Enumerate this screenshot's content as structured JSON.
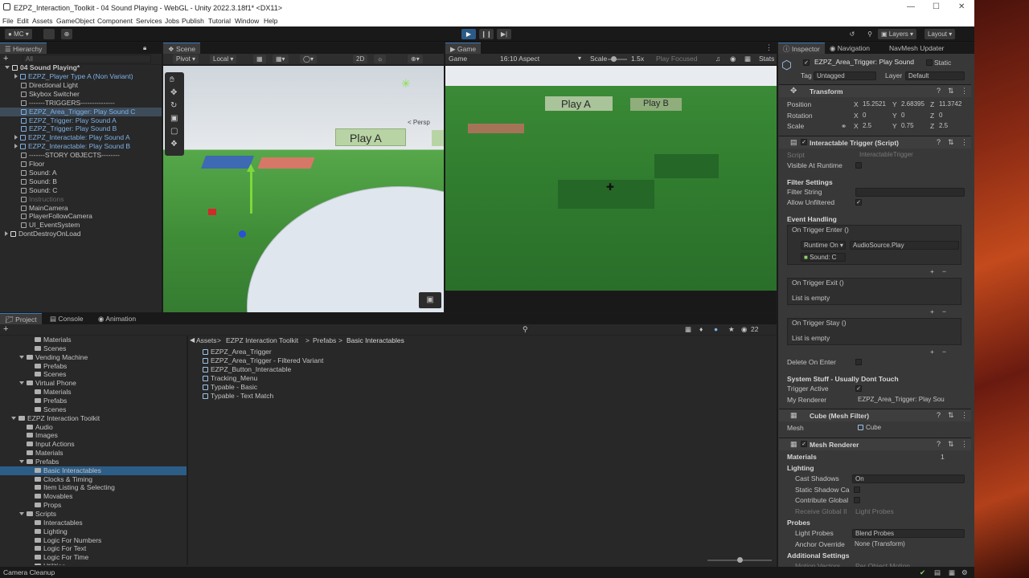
{
  "window": {
    "title": "EZPZ_Interaction_Toolkit - 04 Sound Playing - WebGL - Unity 2022.3.18f1* <DX11>",
    "min": "—",
    "max": "☐",
    "close": "✕"
  },
  "menu": [
    "File",
    "Edit",
    "Assets",
    "GameObject",
    "Component",
    "Services",
    "Jobs",
    "Publish",
    "Tutorial",
    "Window",
    "Help"
  ],
  "toolbar": {
    "account": "MC",
    "layers": "Layers",
    "layout": "Layout"
  },
  "hierarchy": {
    "tab": "Hierarchy",
    "search": "All",
    "scene": "04 Sound Playing*",
    "items": [
      {
        "label": "EZPZ_Player Type A (Non Variant)",
        "indent": 1,
        "blue": true,
        "arrow": true
      },
      {
        "label": "Directional Light",
        "indent": 1
      },
      {
        "label": "Skybox Switcher",
        "indent": 1
      },
      {
        "label": "-------TRIGGERS---------------",
        "indent": 1
      },
      {
        "label": "EZPZ_Area_Trigger: Play Sound C",
        "indent": 1,
        "blue": true,
        "selected": true
      },
      {
        "label": "EZPZ_Trigger: Play Sound A",
        "indent": 1,
        "blue": true
      },
      {
        "label": "EZPZ_Trigger: Play Sound B",
        "indent": 1,
        "blue": true
      },
      {
        "label": "EZPZ_Interactable: Play Sound A",
        "indent": 1,
        "blue": true,
        "arrow": true
      },
      {
        "label": "EZPZ_Interactable: Play Sound B",
        "indent": 1,
        "blue": true,
        "arrow": true
      },
      {
        "label": "-------STORY OBJECTS--------",
        "indent": 1
      },
      {
        "label": "Floor",
        "indent": 1
      },
      {
        "label": "Sound: A",
        "indent": 1
      },
      {
        "label": "Sound: B",
        "indent": 1
      },
      {
        "label": "Sound: C",
        "indent": 1
      },
      {
        "label": "Instructions",
        "indent": 1,
        "dim": true
      },
      {
        "label": "MainCamera",
        "indent": 1
      },
      {
        "label": "PlayerFollowCamera",
        "indent": 1
      },
      {
        "label": "UI_EventSystem",
        "indent": 1
      },
      {
        "label": "DontDestroyOnLoad",
        "indent": 0,
        "scene": true
      }
    ]
  },
  "scene": {
    "tab": "Scene",
    "pivot": "Pivot",
    "local": "Local",
    "mode2d": "2D",
    "persp": "< Persp",
    "sign": "Play A"
  },
  "game": {
    "tab": "Game",
    "display": "Game",
    "aspect": "16:10 Aspect",
    "scale_label": "Scale",
    "scale_value": "1.5x",
    "play_focused": "Play Focused",
    "stats": "Stats",
    "sign_a": "Play A",
    "sign_b": "Play B"
  },
  "project": {
    "tabs": [
      "Project",
      "Console",
      "Animation"
    ],
    "count": "22",
    "breadcrumb": [
      "Assets",
      "EZPZ Interaction Toolkit",
      "Prefabs",
      "Basic Interactables"
    ],
    "tree": [
      {
        "label": "Materials",
        "indent": 3
      },
      {
        "label": "Scenes",
        "indent": 3
      },
      {
        "label": "Vending Machine",
        "indent": 2,
        "open": true
      },
      {
        "label": "Prefabs",
        "indent": 3
      },
      {
        "label": "Scenes",
        "indent": 3
      },
      {
        "label": "Virtual Phone",
        "indent": 2,
        "open": true
      },
      {
        "label": "Materials",
        "indent": 3
      },
      {
        "label": "Prefabs",
        "indent": 3
      },
      {
        "label": "Scenes",
        "indent": 3
      },
      {
        "label": "EZPZ Interaction Toolkit",
        "indent": 1,
        "open": true
      },
      {
        "label": "Audio",
        "indent": 2
      },
      {
        "label": "Images",
        "indent": 2
      },
      {
        "label": "Input Actions",
        "indent": 2
      },
      {
        "label": "Materials",
        "indent": 2
      },
      {
        "label": "Prefabs",
        "indent": 2,
        "open": true
      },
      {
        "label": "Basic Interactables",
        "indent": 3,
        "selected": true
      },
      {
        "label": "Clocks & Timing",
        "indent": 3
      },
      {
        "label": "Item Listing & Selecting",
        "indent": 3
      },
      {
        "label": "Movables",
        "indent": 3
      },
      {
        "label": "Props",
        "indent": 3
      },
      {
        "label": "Scripts",
        "indent": 2,
        "open": true
      },
      {
        "label": "Interactables",
        "indent": 3
      },
      {
        "label": "Lighting",
        "indent": 3
      },
      {
        "label": "Logic For Numbers",
        "indent": 3
      },
      {
        "label": "Logic For Text",
        "indent": 3
      },
      {
        "label": "Logic For Time",
        "indent": 3
      },
      {
        "label": "Utilities",
        "indent": 3
      }
    ],
    "assets": [
      "EZPZ_Area_Trigger",
      "EZPZ_Area_Trigger - Filtered Variant",
      "EZPZ_Button_Interactable",
      "Tracking_Menu",
      "Typable - Basic",
      "Typable - Text Match"
    ]
  },
  "inspector": {
    "tabs": [
      "Inspector",
      "Navigation",
      "NavMesh Updater"
    ],
    "object_name": "EZPZ_Area_Trigger: Play Sound",
    "static": "Static",
    "tag_label": "Tag",
    "tag": "Untagged",
    "layer_label": "Layer",
    "layer": "Default",
    "transform": {
      "title": "Transform",
      "position": {
        "label": "Position",
        "x": "15.2521",
        "y": "2.68395",
        "z": "11.3742"
      },
      "rotation": {
        "label": "Rotation",
        "x": "0",
        "y": "0",
        "z": "0"
      },
      "scale": {
        "label": "Scale",
        "x": "2.5",
        "y": "0.75",
        "z": "2.5"
      }
    },
    "interactable": {
      "title": "Interactable Trigger (Script)",
      "script_label": "Script",
      "script": "InteractableTrigger",
      "visible_label": "Visible At Runtime",
      "filter_header": "Filter Settings",
      "filter_string": "Filter String",
      "allow_unfiltered": "Allow Unfiltered",
      "event_header": "Event Handling",
      "enter": "On Trigger Enter ()",
      "runtime": "Runtime On",
      "func": "AudioSource.Play",
      "target": "Sound: C",
      "exit": "On Trigger Exit ()",
      "stay": "On Trigger Stay ()",
      "empty": "List is empty",
      "delete": "Delete On Enter",
      "system_header": "System Stuff - Usually Dont Touch",
      "trigger_active": "Trigger Active",
      "my_renderer": "My Renderer",
      "renderer_value": "EZPZ_Area_Trigger: Play Sou"
    },
    "mesh_filter": {
      "title": "Cube (Mesh Filter)",
      "mesh_label": "Mesh",
      "mesh": "Cube"
    },
    "mesh_renderer": {
      "title": "Mesh Renderer",
      "materials": "Materials",
      "materials_count": "1",
      "lighting": "Lighting",
      "cast_shadows": "Cast Shadows",
      "cast_value": "On",
      "static_shadow": "Static Shadow Ca",
      "contribute": "Contribute Global",
      "receive": "Receive Global Il",
      "receive_value": "Light Probes",
      "probes": "Probes",
      "light_probes": "Light Probes",
      "light_probes_value": "Blend Probes",
      "anchor": "Anchor Override",
      "anchor_value": "None (Transform)",
      "additional": "Additional Settings",
      "motion": "Motion Vectors",
      "motion_value": "Per Object Motion"
    }
  },
  "status": {
    "text": "Camera Cleanup"
  }
}
